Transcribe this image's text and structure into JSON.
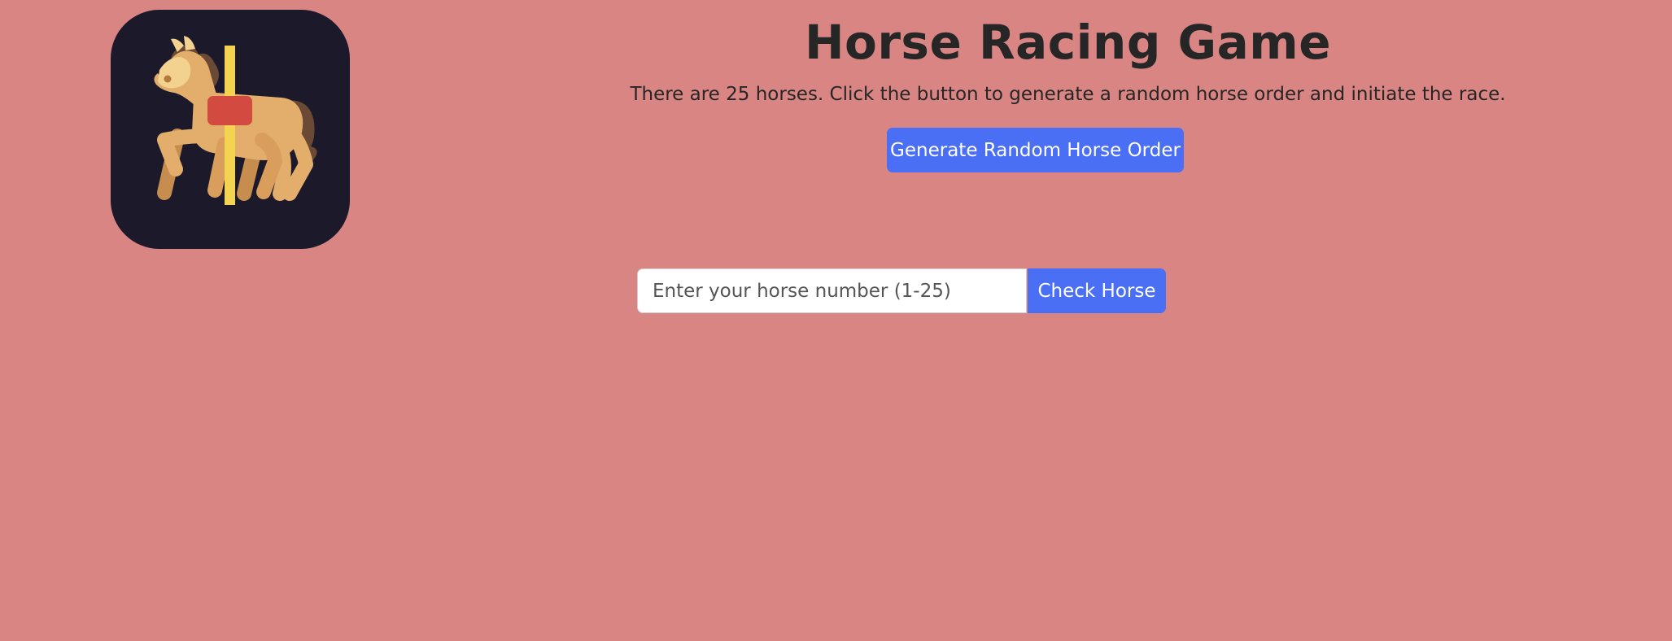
{
  "app": {
    "logo_icon": "carousel-horse-icon",
    "title": "Horse Racing Game",
    "description": "There are 25 horses. Click the button to generate a random horse order and initiate the race."
  },
  "actions": {
    "generate_label": "Generate Random Horse Order"
  },
  "check": {
    "input_value": "",
    "input_placeholder": "Enter your horse number (1-25)",
    "button_label": "Check Horse"
  },
  "colors": {
    "page_background": "#d98583",
    "logo_background": "#1b192a",
    "button_primary": "#4a6ff5",
    "text_dark": "#262626"
  }
}
